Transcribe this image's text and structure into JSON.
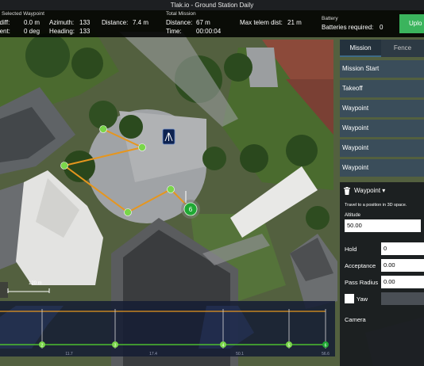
{
  "window": {
    "title": "Tlak.io - Ground Station Daily"
  },
  "selected_waypoint": {
    "header": "Selected Waypoint",
    "alt_diff_label": "Alt diff:",
    "alt_diff_value": "0.0 m",
    "gradient_label": "Gradient:",
    "gradient_value": "0 deg",
    "azimuth_label": "Azimuth:",
    "azimuth_value": "133",
    "heading_label": "Heading:",
    "heading_value": "133",
    "distance_label": "Distance:",
    "distance_value": "7.4 m"
  },
  "total_mission": {
    "header": "Total Mission",
    "distance_label": "Distance:",
    "distance_value": "67 m",
    "time_label": "Time:",
    "time_value": "00:00:04",
    "max_telem_label": "Max telem dist:",
    "max_telem_value": "21 m"
  },
  "battery": {
    "header": "Battery",
    "required_label": "Batteries required:",
    "required_value": "0"
  },
  "upload_button": "Uplo",
  "tabs": {
    "mission": "Mission",
    "fence": "Fence"
  },
  "mission_items": [
    "Mission Start",
    "Takeoff",
    "Waypoint",
    "Waypoint",
    "Waypoint",
    "Waypoint"
  ],
  "editor": {
    "title": "Waypoint",
    "description": "Travel to a position in 3D space.",
    "altitude_label": "Altitude",
    "altitude_value": "50.00",
    "hold_label": "Hold",
    "hold_value": "0",
    "acceptance_label": "Acceptance",
    "acceptance_value": "0.00",
    "pass_radius_label": "Pass Radius",
    "pass_radius_value": "0.00",
    "yaw_label": "Yaw",
    "camera_label": "Camera"
  },
  "map": {
    "scale_label": "120 m",
    "current_waypoint_number": "6"
  },
  "profile": {
    "waypoint_numbers": [
      "2",
      "3",
      "4",
      "5",
      "6"
    ],
    "axis_ticks": [
      "11.7",
      "17.4",
      "50.1",
      "56.6"
    ]
  },
  "colors": {
    "path": "#e6961e",
    "waypoint": "#7ad64a",
    "current_waypoint": "#1fa833",
    "upload": "#3bb45d",
    "panel": "#384c5c"
  }
}
